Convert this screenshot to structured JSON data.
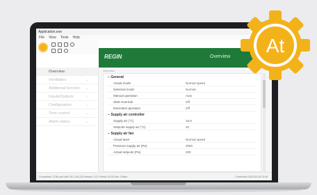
{
  "window": {
    "title": "Application.exe"
  },
  "menu": [
    "File",
    "View",
    "Tools",
    "Help"
  ],
  "header": {
    "brand": "REGIN",
    "title": "Overview"
  },
  "sidebar": {
    "items": [
      {
        "label": "Overview",
        "active": true
      },
      {
        "label": "Ventilation",
        "active": false
      },
      {
        "label": "Additional function",
        "active": false
      },
      {
        "label": "Inputs/Outputs",
        "active": false
      },
      {
        "label": "Configuration",
        "active": false
      },
      {
        "label": "Time control",
        "active": false
      },
      {
        "label": "Alarm status",
        "active": false
      }
    ]
  },
  "content": {
    "breadcrumb": "Overview",
    "sections": [
      {
        "title": "General",
        "rows": [
          {
            "label": "Actual mode",
            "value": "Normal speed"
          },
          {
            "label": "Selected mode",
            "value": "Normal"
          },
          {
            "label": "Manual operation",
            "value": "Auto"
          },
          {
            "label": "SMS Override",
            "value": "Off"
          },
          {
            "label": "Extended operation",
            "value": "Off"
          }
        ]
      },
      {
        "title": "Supply air controller",
        "rows": [
          {
            "label": "Supply air (°C)",
            "value": "19.8"
          },
          {
            "label": "Setpoint supply air (°C)",
            "value": "20"
          }
        ]
      },
      {
        "title": "Supply air fan",
        "rows": [
          {
            "label": "Actual level",
            "value": "Normal speed"
          },
          {
            "label": "Pressure supply air (Pa)",
            "value": "2000"
          },
          {
            "label": "Actual setpoint (Pa)",
            "value": "200"
          }
        ]
      }
    ]
  },
  "statusbar": {
    "left": "Connected: COM port   Unit: RLC-W1-0A   Version: 2.0.0   Serial: 00-00   Info: Online",
    "right": "Connected   2024-03-18 12:48"
  },
  "badge": {
    "text": "At"
  },
  "colors": {
    "header": "#1f7a3a",
    "badge": "#f4b21a"
  }
}
